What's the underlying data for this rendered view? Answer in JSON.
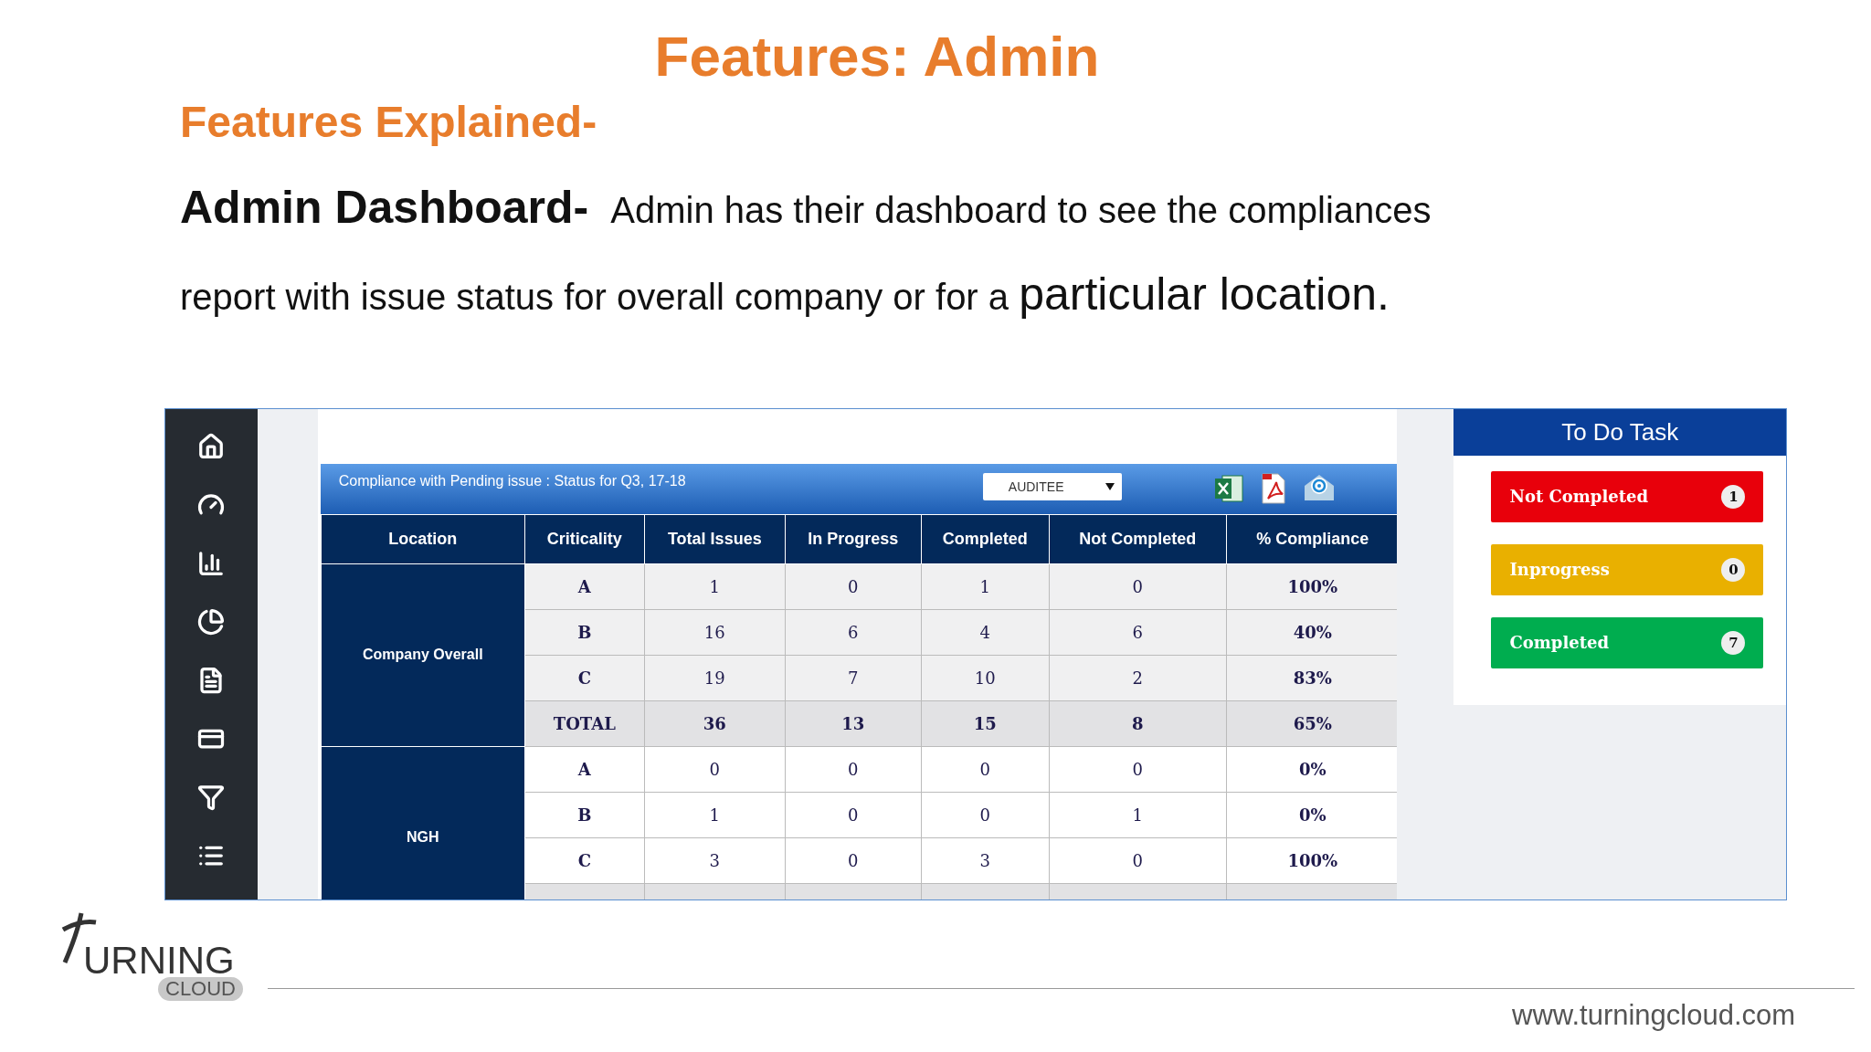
{
  "title": "Features: Admin",
  "subtitle": "Features Explained-",
  "description": {
    "lead": "Admin Dashboard-",
    "text": "Admin has their dashboard to see the compliances report with issue status for overall company or for a",
    "large_text": "particular location."
  },
  "dashboard": {
    "sidebar": {
      "items": [
        {
          "kind": "home"
        },
        {
          "kind": "gauge"
        },
        {
          "kind": "bars"
        },
        {
          "kind": "pie"
        },
        {
          "kind": "document"
        },
        {
          "kind": "card"
        },
        {
          "kind": "filter"
        },
        {
          "kind": "list"
        }
      ]
    },
    "report": {
      "title": "Compliance with Pending issue : Status for Q3, 17-18",
      "dropdown": {
        "value": "AUDITEE"
      },
      "actions": [
        {
          "kind": "excel"
        },
        {
          "kind": "pdf"
        },
        {
          "kind": "email"
        }
      ],
      "columns": [
        "Location",
        "Criticality",
        "Total Issues",
        "In Progress",
        "Completed",
        "Not Completed",
        "% Compliance"
      ],
      "groups": [
        {
          "location": "Company Overall",
          "shaded": true,
          "clipped_row": false,
          "rows": [
            {
              "kind": "row",
              "cells": [
                "A",
                "1",
                "0",
                "1",
                "0",
                "100%"
              ]
            },
            {
              "kind": "row",
              "cells": [
                "B",
                "16",
                "6",
                "4",
                "6",
                "40%"
              ]
            },
            {
              "kind": "row",
              "cells": [
                "C",
                "19",
                "7",
                "10",
                "2",
                "83%"
              ]
            },
            {
              "kind": "total",
              "cells": [
                "TOTAL",
                "36",
                "13",
                "15",
                "8",
                "65%"
              ]
            }
          ]
        },
        {
          "location": "NGH",
          "shaded": false,
          "clipped_row": true,
          "rows": [
            {
              "kind": "row",
              "cells": [
                "A",
                "0",
                "0",
                "0",
                "0",
                "0%"
              ]
            },
            {
              "kind": "row",
              "cells": [
                "B",
                "1",
                "0",
                "0",
                "1",
                "0%"
              ]
            },
            {
              "kind": "row",
              "cells": [
                "C",
                "3",
                "0",
                "3",
                "0",
                "100%"
              ]
            }
          ]
        }
      ]
    },
    "todo": {
      "title": "To Do Task",
      "items": [
        {
          "label": "Not Completed",
          "count": "1",
          "color": "#e8000b"
        },
        {
          "label": "Inprogress",
          "count": "0",
          "color": "#e9b000"
        },
        {
          "label": "Completed",
          "count": "7",
          "color": "#00ad4f"
        }
      ]
    }
  },
  "footer": {
    "logo": {
      "main": "URNING",
      "sub": "CLOUD"
    },
    "url": "www.turningcloud.com"
  }
}
